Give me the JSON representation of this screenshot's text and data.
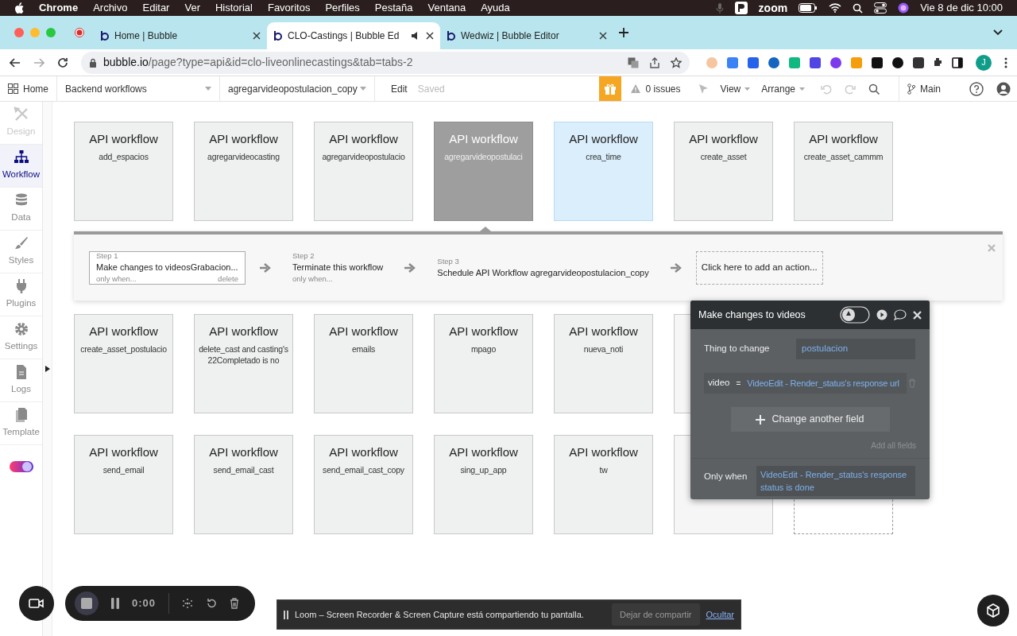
{
  "menu_bar": {
    "app": "Chrome",
    "items": [
      "Archivo",
      "Editar",
      "Ver",
      "Historial",
      "Favoritos",
      "Perfiles",
      "Pestaña",
      "Ventana",
      "Ayuda"
    ],
    "zoom_label": "zoom",
    "clock": "Vie 8 de dic 10:00"
  },
  "tabs": [
    {
      "title": "Home | Bubble",
      "selected": false
    },
    {
      "title": "CLO-Castings | Bubble Ed",
      "selected": true
    },
    {
      "title": "Wedwiz | Bubble Editor",
      "selected": false
    }
  ],
  "address": {
    "host": "bubble.io",
    "path": "/page?type=api&id=clo-liveonlinecastings&tab=tabs-2",
    "profile": "J"
  },
  "toolbar": {
    "home": "Home",
    "page": "Backend workflows",
    "workflow": "agregarvideopostulacion_copy",
    "edit": "Edit",
    "saved": "Saved",
    "issues": "0 issues",
    "view": "View",
    "arrange": "Arrange",
    "branch": "Main"
  },
  "sidebar": [
    {
      "label": "Design",
      "selected": false,
      "disabled": true
    },
    {
      "label": "Workflow",
      "selected": true,
      "disabled": false
    },
    {
      "label": "Data",
      "selected": false,
      "disabled": false
    },
    {
      "label": "Styles",
      "selected": false,
      "disabled": false
    },
    {
      "label": "Plugins",
      "selected": false,
      "disabled": false
    },
    {
      "label": "Settings",
      "selected": false,
      "disabled": false
    },
    {
      "label": "Logs",
      "selected": false,
      "disabled": false
    },
    {
      "label": "Template",
      "selected": false,
      "disabled": false
    }
  ],
  "rows": [
    [
      {
        "kind": "workflow",
        "title": "API workflow",
        "name": "add_espacios",
        "selected": false,
        "highlighted": false
      },
      {
        "kind": "workflow",
        "title": "API workflow",
        "name": "agregarvideocasting",
        "selected": false,
        "highlighted": false
      },
      {
        "kind": "workflow",
        "title": "API workflow",
        "name": "agregarvideopostulacio",
        "selected": false,
        "highlighted": false
      },
      {
        "kind": "workflow",
        "title": "API workflow",
        "name": "agregarvideopostulaci",
        "selected": true,
        "highlighted": false
      },
      {
        "kind": "workflow",
        "title": "API workflow",
        "name": "crea_time",
        "selected": false,
        "highlighted": true
      },
      {
        "kind": "workflow",
        "title": "API workflow",
        "name": "create_asset",
        "selected": false,
        "highlighted": false
      },
      {
        "kind": "workflow",
        "title": "API workflow",
        "name": "create_asset_cammm",
        "selected": false,
        "highlighted": false
      }
    ],
    [
      {
        "kind": "workflow",
        "title": "API workflow",
        "name": "create_asset_postulacio",
        "selected": false,
        "highlighted": false
      },
      {
        "kind": "workflow",
        "title": "API workflow",
        "name": "delete_cast and casting's 22Completado is no",
        "selected": false,
        "highlighted": false
      },
      {
        "kind": "workflow",
        "title": "API workflow",
        "name": "emails",
        "selected": false,
        "highlighted": false
      },
      {
        "kind": "workflow",
        "title": "API workflow",
        "name": "mpago",
        "selected": false,
        "highlighted": false
      },
      {
        "kind": "workflow",
        "title": "API workflow",
        "name": "nueva_noti",
        "selected": false,
        "highlighted": false
      },
      {
        "kind": "covered"
      }
    ],
    [
      {
        "kind": "workflow",
        "title": "API workflow",
        "name": "send_email",
        "selected": false,
        "highlighted": false
      },
      {
        "kind": "workflow",
        "title": "API workflow",
        "name": "send_email_cast",
        "selected": false,
        "highlighted": false
      },
      {
        "kind": "workflow",
        "title": "API workflow",
        "name": "send_email_cast_copy",
        "selected": false,
        "highlighted": false
      },
      {
        "kind": "workflow",
        "title": "API workflow",
        "name": "sing_up_app",
        "selected": false,
        "highlighted": false
      },
      {
        "kind": "workflow",
        "title": "API workflow",
        "name": "tw",
        "selected": false,
        "highlighted": false
      },
      {
        "kind": "covered"
      },
      {
        "kind": "placeholder"
      }
    ]
  ],
  "steps": [
    {
      "label": "Step 1",
      "action": "Make changes to videosGrabacion...",
      "condition": "only when...",
      "delete": "delete",
      "selected": true
    },
    {
      "label": "Step 2",
      "action": "Terminate this workflow",
      "condition": "only when...",
      "selected": false
    },
    {
      "label": "Step 3",
      "action": "Schedule API Workflow agregarvideopostulacion_copy",
      "selected": false
    }
  ],
  "add_action": "Click here to add an action...",
  "action_editor": {
    "title": "Make changes to videos",
    "thing_label": "Thing to change",
    "thing_value": "postulacion",
    "field_name": "video",
    "equals": "=",
    "field_value": "VideoEdit - Render_status's response url",
    "add_field": "Change another field",
    "add_all": "Add all fields",
    "only_when_label": "Only when",
    "only_when_value": "VideoEdit - Render_status's response status is done"
  },
  "recorder": {
    "timer": "0:00"
  },
  "share_banner": {
    "message": "Loom – Screen Recorder & Screen Capture está compartiendo tu pantalla.",
    "stop": "Dejar de compartir",
    "hide": "Ocultar"
  }
}
